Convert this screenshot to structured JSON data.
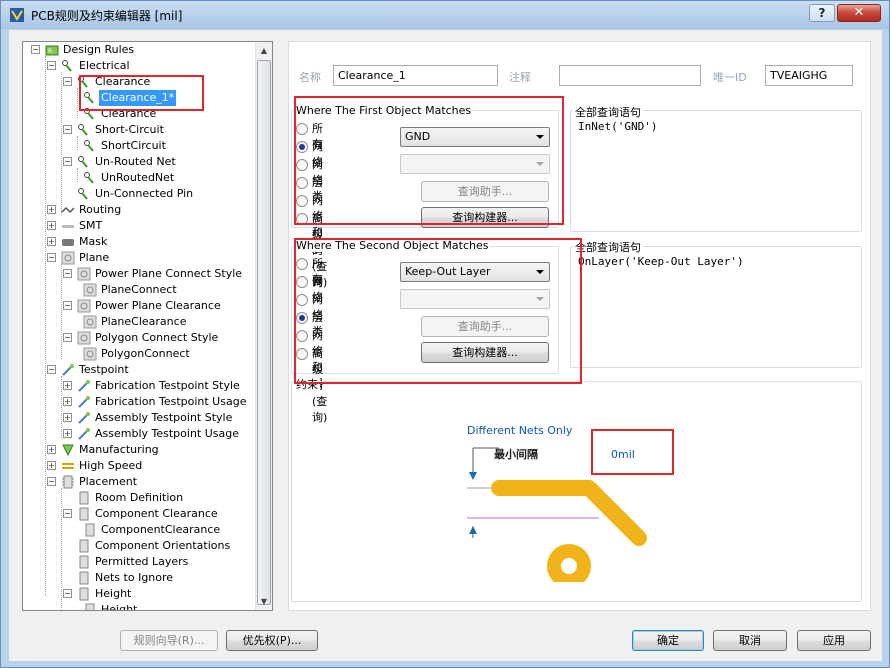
{
  "window": {
    "title": "PCB规则及约束编辑器 [mil]",
    "help_label": "?",
    "close_label": "✕"
  },
  "tree": {
    "items": [
      {
        "label": "Design Rules"
      },
      {
        "label": "Electrical"
      },
      {
        "label": "Clearance"
      },
      {
        "label": "Clearance_1*"
      },
      {
        "label": "Clearance"
      },
      {
        "label": "Short-Circuit"
      },
      {
        "label": "ShortCircuit"
      },
      {
        "label": "Un-Routed Net"
      },
      {
        "label": "UnRoutedNet"
      },
      {
        "label": "Un-Connected Pin"
      },
      {
        "label": "Routing"
      },
      {
        "label": "SMT"
      },
      {
        "label": "Mask"
      },
      {
        "label": "Plane"
      },
      {
        "label": "Power Plane Connect Style"
      },
      {
        "label": "PlaneConnect"
      },
      {
        "label": "Power Plane Clearance"
      },
      {
        "label": "PlaneClearance"
      },
      {
        "label": "Polygon Connect Style"
      },
      {
        "label": "PolygonConnect"
      },
      {
        "label": "Testpoint"
      },
      {
        "label": "Fabrication Testpoint Style"
      },
      {
        "label": "Fabrication Testpoint Usage"
      },
      {
        "label": "Assembly Testpoint Style"
      },
      {
        "label": "Assembly Testpoint Usage"
      },
      {
        "label": "Manufacturing"
      },
      {
        "label": "High Speed"
      },
      {
        "label": "Placement"
      },
      {
        "label": "Room Definition"
      },
      {
        "label": "Component Clearance"
      },
      {
        "label": "ComponentClearance"
      },
      {
        "label": "Component Orientations"
      },
      {
        "label": "Permitted Layers"
      },
      {
        "label": "Nets to Ignore"
      },
      {
        "label": "Height"
      },
      {
        "label": "Height"
      }
    ]
  },
  "rule": {
    "name_label": "名称",
    "name_value": "Clearance_1",
    "comment_label": "注释",
    "comment_value": "",
    "uid_label": "唯一ID",
    "uid_value": "TVEAIGHG"
  },
  "first": {
    "title": "Where The First Object Matches",
    "options": [
      "所有",
      "网络",
      "网络类",
      "层",
      "网络和层",
      "高级的(查询)"
    ],
    "net_value": "GND",
    "netclass_value": "",
    "helper_label": "查询助手...",
    "builder_label": "查询构建器...",
    "query_title": "全部查询语句",
    "query_text": "InNet('GND')"
  },
  "second": {
    "title": "Where The Second Object Matches",
    "options": [
      "所有",
      "网络",
      "网络类",
      "层",
      "网络和层",
      "高级的(查询)"
    ],
    "layer_value": "Keep-Out Layer",
    "netclass_value": "",
    "helper_label": "查询助手...",
    "builder_label": "查询构建器...",
    "query_title": "全部查询语句",
    "query_text": "OnLayer('Keep-Out Layer')"
  },
  "constraints": {
    "title": "约束",
    "mode_label": "Different Nets Only",
    "min_label": "最小间隔",
    "value": "0mil"
  },
  "footer": {
    "wizard_label": "规则向导(R)...",
    "priority_label": "优先权(P)...",
    "ok_label": "确定",
    "cancel_label": "取消",
    "apply_label": "应用"
  },
  "colors": {
    "highlight": "#e0262d",
    "selection": "#3399ff",
    "copper": "#f0b41a"
  }
}
